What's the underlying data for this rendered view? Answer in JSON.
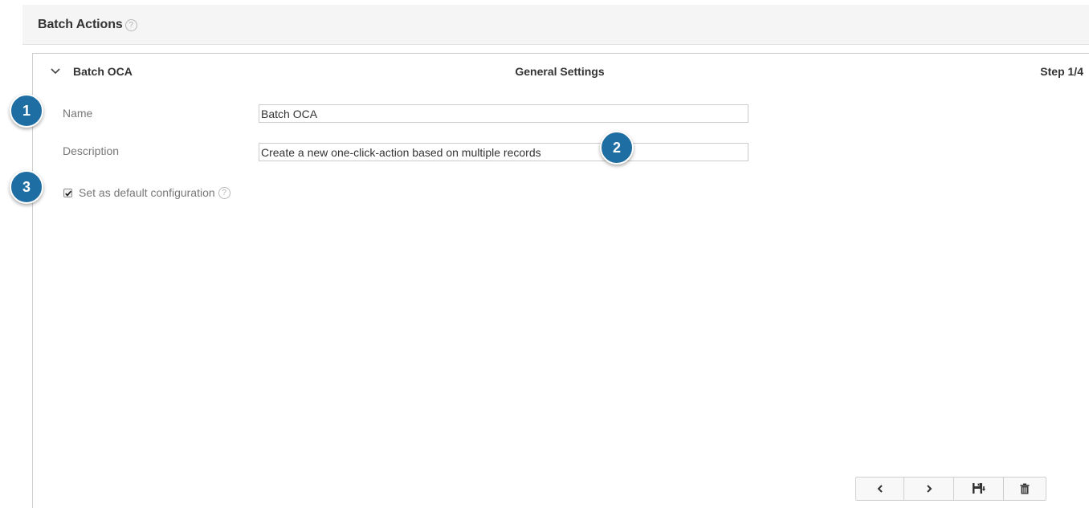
{
  "panel": {
    "title": "Batch Actions",
    "help_glyph": "?"
  },
  "card": {
    "name": "Batch OCA",
    "section_title": "General Settings",
    "step": "Step 1/4",
    "toggle_icon": "chevron-down-icon"
  },
  "form": {
    "name_label": "Name",
    "name_value": "Batch OCA",
    "description_label": "Description",
    "description_value": "Create a new one-click-action based on multiple records",
    "default_label": "Set as default configuration",
    "default_checked": true,
    "help_glyph": "?"
  },
  "toolbar": {
    "buttons": [
      {
        "icon": "chevron-left-icon"
      },
      {
        "icon": "chevron-right-icon"
      },
      {
        "icon": "save-icon"
      },
      {
        "icon": "trash-icon"
      }
    ]
  },
  "callouts": [
    "1",
    "2",
    "3"
  ],
  "colors": {
    "callout": "#1f6ea3",
    "header_bg": "#f5f5f5",
    "label": "#777777",
    "text": "#333333",
    "border": "#cfcfcf"
  }
}
